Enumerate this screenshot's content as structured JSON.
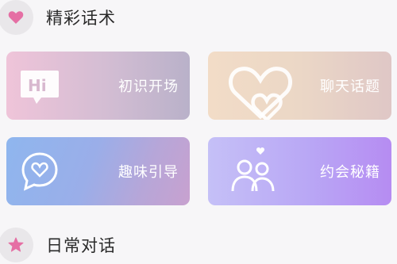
{
  "sections": [
    {
      "title": "精彩话术",
      "icon": "heart-icon"
    },
    {
      "title": "日常对话",
      "icon": "star-icon"
    }
  ],
  "cards": [
    {
      "label": "初识开场",
      "icon": "hi-bubble-icon"
    },
    {
      "label": "聊天话题",
      "icon": "hearts-icon"
    },
    {
      "label": "趣味引导",
      "icon": "heart-chat-icon"
    },
    {
      "label": "约会秘籍",
      "icon": "couple-icon"
    }
  ],
  "colors": {
    "accent": "#e56fa4",
    "section_bg": "#e9e7ea"
  }
}
